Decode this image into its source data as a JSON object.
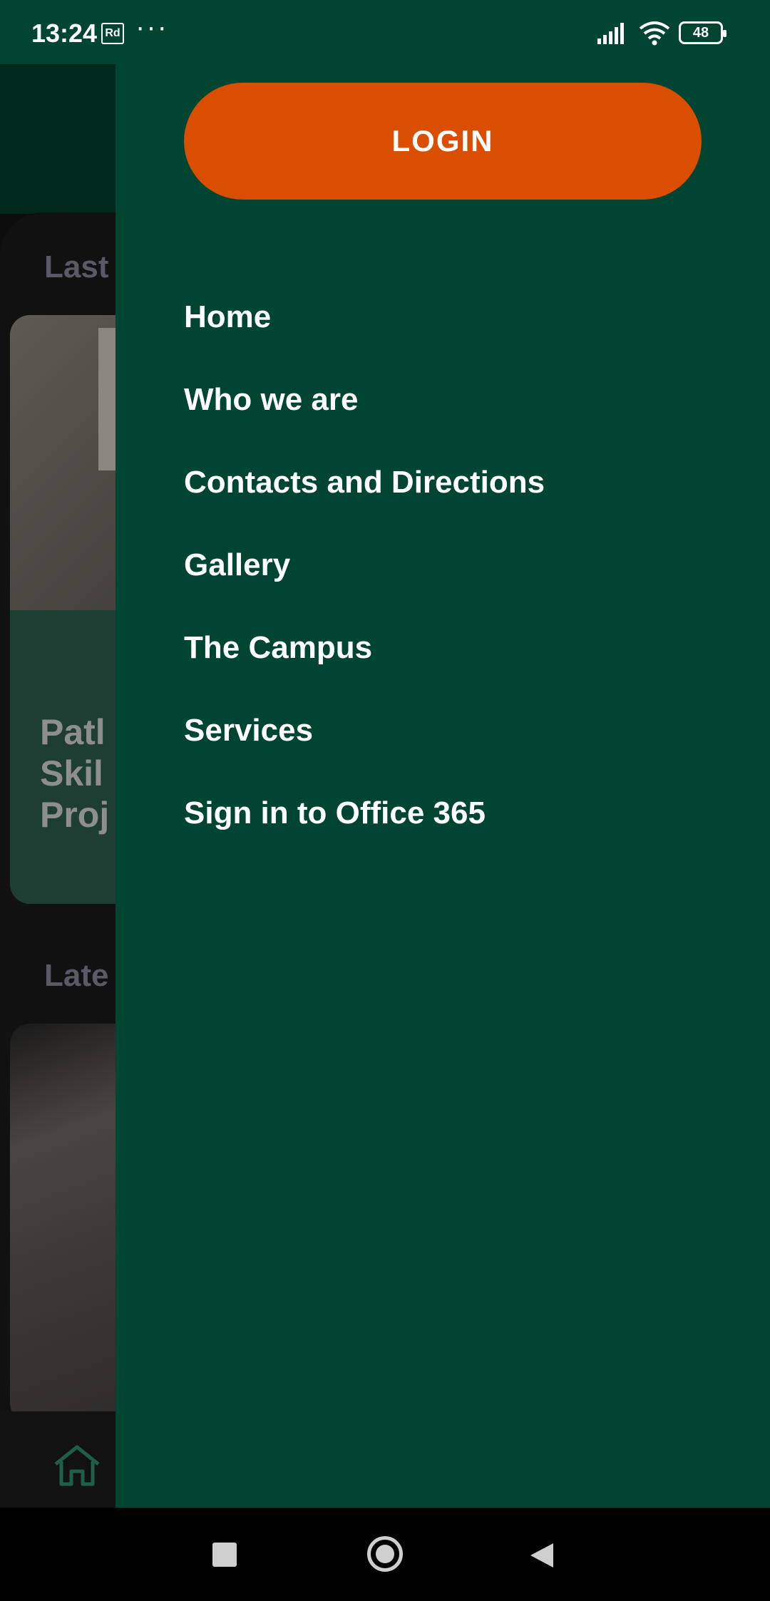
{
  "status_bar": {
    "time": "13:24",
    "badge": "Rd",
    "dots": "···",
    "battery": "48"
  },
  "background": {
    "section_1_partial": "Last",
    "card_title_partial": "Patl\nSkil\nProj",
    "section_2_partial": "Late"
  },
  "drawer": {
    "login_label": "LOGIN",
    "menu_items": [
      {
        "label": "Home"
      },
      {
        "label": "Who we are"
      },
      {
        "label": "Contacts and Directions"
      },
      {
        "label": "Gallery"
      },
      {
        "label": "The Campus"
      },
      {
        "label": "Services"
      },
      {
        "label": "Sign in to Office 365"
      }
    ]
  },
  "colors": {
    "drawer_bg": "#004532",
    "login_button": "#d94e00",
    "text": "#ffffff"
  },
  "icons": [
    "signal-icon",
    "wifi-icon",
    "battery-icon",
    "home-icon",
    "nav-recent-icon",
    "nav-home-icon",
    "nav-back-icon"
  ]
}
